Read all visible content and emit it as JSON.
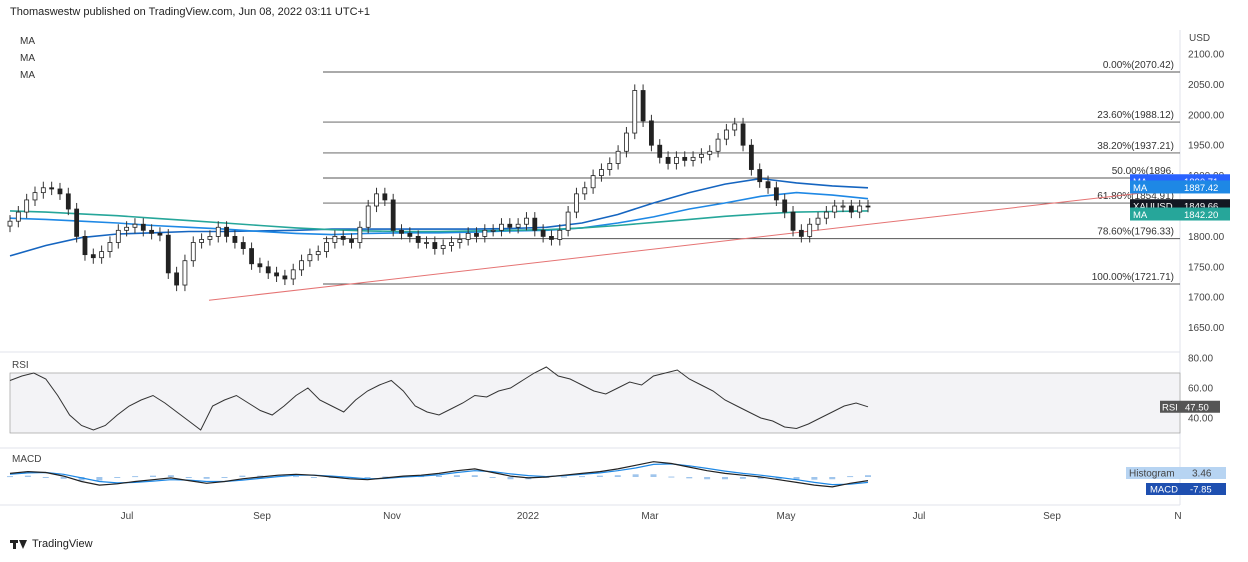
{
  "header": {
    "published": "Thomaswestw published on TradingView.com, Jun 08, 2022 03:11 UTC+1"
  },
  "ma_labels": [
    "MA",
    "MA",
    "MA"
  ],
  "footer": {
    "brand": "TradingView"
  },
  "chart_data": {
    "type": "candlestick",
    "symbol_tag": "XAUUSD",
    "currency": "USD",
    "main_y_ticks": [
      2100,
      2050,
      2000,
      1950,
      1900,
      1850,
      1800,
      1750,
      1700,
      1650
    ],
    "x_labels": [
      "Jul",
      "Sep",
      "Nov",
      "2022",
      "Mar",
      "May",
      "Jul",
      "Sep",
      "N"
    ],
    "fib_levels": [
      {
        "label": "0.00%(2070.42)",
        "value": 2070.42
      },
      {
        "label": "23.60%(1988.12)",
        "value": 1988.12
      },
      {
        "label": "38.20%(1937.21)",
        "value": 1937.21
      },
      {
        "label": "50.00%(1896.",
        "value": 1896.07
      },
      {
        "label": "61.80%(1854.91)",
        "value": 1854.91
      },
      {
        "label": "78.60%(1796.33)",
        "value": 1796.33
      },
      {
        "label": "100.00%(1721.71)",
        "value": 1721.71
      }
    ],
    "price_tags": [
      {
        "name": "MA",
        "value": "1890.71",
        "color": "#2962ff",
        "level": 1890.71
      },
      {
        "name": "MA",
        "value": "1887.42",
        "color": "#1e88e5",
        "level": 1880.5
      },
      {
        "name": "XAUUSD",
        "value": "1849.66",
        "color": "#131722",
        "level": 1849.66
      },
      {
        "name": "MA",
        "value": "1842.20",
        "color": "#26a69a",
        "level": 1836
      }
    ],
    "price_series": [
      1825,
      1840,
      1860,
      1872,
      1880,
      1878,
      1870,
      1845,
      1800,
      1770,
      1765,
      1775,
      1790,
      1810,
      1815,
      1820,
      1810,
      1805,
      1802,
      1740,
      1720,
      1760,
      1790,
      1795,
      1800,
      1815,
      1800,
      1790,
      1780,
      1755,
      1750,
      1740,
      1735,
      1730,
      1745,
      1760,
      1770,
      1775,
      1790,
      1800,
      1795,
      1790,
      1815,
      1850,
      1870,
      1860,
      1810,
      1805,
      1800,
      1790,
      1790,
      1780,
      1785,
      1790,
      1795,
      1805,
      1800,
      1810,
      1810,
      1820,
      1815,
      1820,
      1830,
      1810,
      1800,
      1795,
      1810,
      1840,
      1870,
      1880,
      1900,
      1910,
      1920,
      1940,
      1970,
      2040,
      1990,
      1950,
      1930,
      1920,
      1930,
      1925,
      1930,
      1935,
      1940,
      1960,
      1975,
      1985,
      1950,
      1910,
      1890,
      1880,
      1860,
      1840,
      1810,
      1800,
      1820,
      1830,
      1840,
      1850,
      1850,
      1840,
      1850,
      1849.66
    ],
    "ma_series": [
      {
        "name": "MA",
        "color": "#1565c0",
        "values": [
          1768,
          1785,
          1798,
          1804,
          1806,
          1808,
          1808,
          1809,
          1810,
          1812,
          1812,
          1812,
          1812,
          1812,
          1813,
          1815,
          1822,
          1836,
          1855,
          1872,
          1886,
          1895,
          1888,
          1883,
          1880
        ]
      },
      {
        "name": "MA",
        "color": "#1e88e5",
        "values": [
          1830,
          1828,
          1825,
          1822,
          1818,
          1815,
          1812,
          1808,
          1805,
          1803,
          1805,
          1806,
          1806,
          1807,
          1809,
          1810,
          1814,
          1822,
          1832,
          1845,
          1855,
          1866,
          1872,
          1868,
          1862
        ]
      },
      {
        "name": "MA",
        "color": "#26a69a",
        "values": [
          1842,
          1840,
          1837,
          1834,
          1830,
          1826,
          1822,
          1818,
          1814,
          1811,
          1809,
          1808,
          1808,
          1809,
          1810,
          1811,
          1814,
          1818,
          1823,
          1828,
          1833,
          1837,
          1840,
          1841,
          1842
        ]
      }
    ],
    "trendline": {
      "from": 1721.71,
      "to": 1920
    },
    "rsi": {
      "label": "RSI",
      "y_ticks": [
        "80.00",
        "60.00",
        "40.00"
      ],
      "band": [
        70,
        30
      ],
      "value_tag": "47.50",
      "values": [
        65,
        68,
        70,
        66,
        55,
        42,
        35,
        32,
        35,
        42,
        48,
        52,
        55,
        50,
        44,
        38,
        32,
        48,
        52,
        55,
        50,
        45,
        42,
        48,
        55,
        60,
        52,
        48,
        44,
        52,
        58,
        62,
        65,
        58,
        48,
        44,
        42,
        46,
        50,
        55,
        54,
        58,
        60,
        65,
        70,
        74,
        68,
        66,
        62,
        58,
        56,
        60,
        64,
        62,
        68,
        70,
        72,
        66,
        62,
        58,
        52,
        48,
        44,
        40,
        38,
        34,
        33,
        36,
        40,
        44,
        48,
        50,
        47.5
      ]
    },
    "macd": {
      "label": "MACD",
      "histogram_label": "Histogram",
      "histogram_value": "3.46",
      "macd_label": "MACD",
      "macd_value": "-7.85",
      "macd_line": [
        8,
        12,
        10,
        2,
        -10,
        -18,
        -15,
        -10,
        -6,
        -2,
        -8,
        -14,
        -10,
        -4,
        0,
        4,
        6,
        4,
        0,
        -4,
        -6,
        -2,
        2,
        4,
        8,
        14,
        18,
        10,
        2,
        -2,
        0,
        4,
        8,
        12,
        18,
        26,
        34,
        30,
        22,
        14,
        8,
        4,
        0,
        -6,
        -12,
        -18,
        -22,
        -14,
        -8
      ],
      "signal_line": [
        6,
        9,
        10,
        6,
        -2,
        -10,
        -13,
        -12,
        -9,
        -6,
        -7,
        -10,
        -10,
        -7,
        -3,
        1,
        4,
        4,
        2,
        -1,
        -4,
        -3,
        0,
        2,
        5,
        10,
        14,
        12,
        7,
        3,
        1,
        3,
        6,
        9,
        14,
        20,
        28,
        29,
        25,
        19,
        13,
        8,
        4,
        -1,
        -6,
        -12,
        -17,
        -16,
        -12
      ],
      "histogram": [
        2,
        3,
        0,
        -4,
        -8,
        -8,
        -2,
        2,
        3,
        4,
        -1,
        -4,
        0,
        3,
        3,
        3,
        2,
        0,
        -2,
        -3,
        -2,
        1,
        2,
        2,
        3,
        4,
        4,
        -2,
        -5,
        -5,
        -1,
        1,
        2,
        3,
        4,
        6,
        6,
        1,
        -3,
        -5,
        -5,
        -4,
        -4,
        -5,
        -6,
        -6,
        -5,
        2,
        4
      ]
    }
  }
}
